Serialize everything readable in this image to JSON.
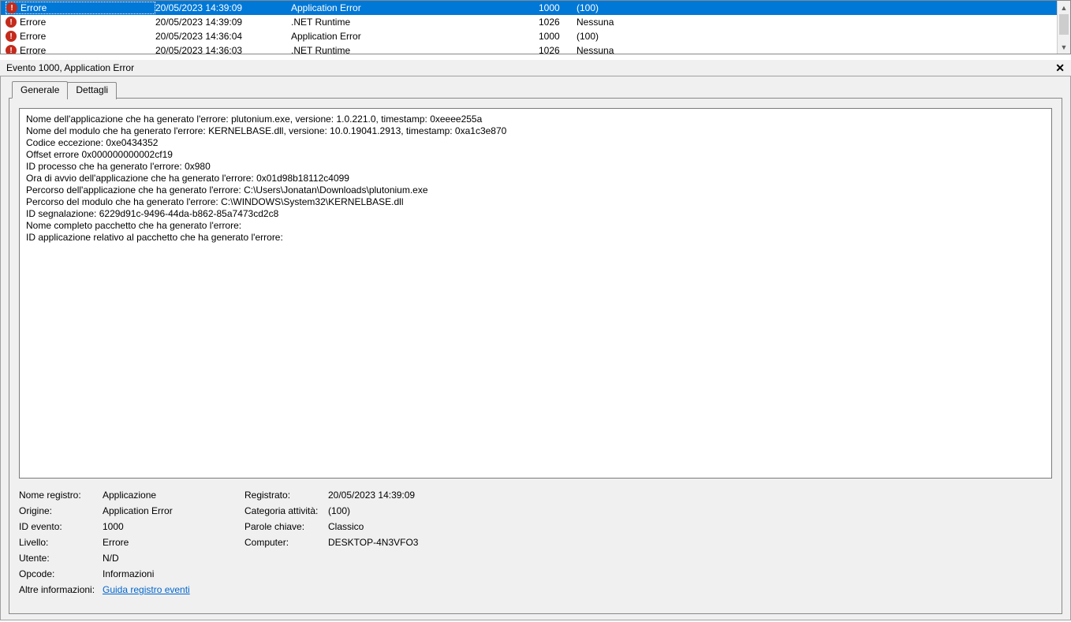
{
  "list": {
    "rows": [
      {
        "level": "Errore",
        "date": "20/05/2023 14:39:09",
        "source": "Application Error",
        "eventid": "1000",
        "category": "(100)",
        "selected": true
      },
      {
        "level": "Errore",
        "date": "20/05/2023 14:39:09",
        "source": ".NET Runtime",
        "eventid": "1026",
        "category": "Nessuna",
        "selected": false
      },
      {
        "level": "Errore",
        "date": "20/05/2023 14:36:04",
        "source": "Application Error",
        "eventid": "1000",
        "category": "(100)",
        "selected": false
      },
      {
        "level": "Errore",
        "date": "20/05/2023 14:36:03",
        "source": ".NET Runtime",
        "eventid": "1026",
        "category": "Nessuna",
        "selected": false
      }
    ]
  },
  "detail": {
    "header_title": "Evento 1000, Application Error",
    "tabs": {
      "general": "Generale",
      "details": "Dettagli"
    },
    "description": "Nome dell'applicazione che ha generato l'errore: plutonium.exe, versione: 1.0.221.0, timestamp: 0xeeee255a\nNome del modulo che ha generato l'errore: KERNELBASE.dll, versione: 10.0.19041.2913, timestamp: 0xa1c3e870\nCodice eccezione: 0xe0434352\nOffset errore 0x000000000002cf19\nID processo che ha generato l'errore: 0x980\nOra di avvio dell'applicazione che ha generato l'errore: 0x01d98b18112c4099\nPercorso dell'applicazione che ha generato l'errore: C:\\Users\\Jonatan\\Downloads\\plutonium.exe\nPercorso del modulo che ha generato l'errore: C:\\WINDOWS\\System32\\KERNELBASE.dll\nID segnalazione: 6229d91c-9496-44da-b862-85a7473cd2c8\nNome completo pacchetto che ha generato l'errore: \nID applicazione relativo al pacchetto che ha generato l'errore: ",
    "props": {
      "log_name_label": "Nome registro:",
      "log_name": "Applicazione",
      "source_label": "Origine:",
      "source": "Application Error",
      "eventid_label": "ID evento:",
      "eventid": "1000",
      "level_label": "Livello:",
      "level": "Errore",
      "user_label": "Utente:",
      "user": "N/D",
      "opcode_label": "Opcode:",
      "opcode": "Informazioni",
      "moreinfo_label": "Altre informazioni:",
      "moreinfo_link": "Guida registro eventi",
      "logged_label": "Registrato:",
      "logged": "20/05/2023 14:39:09",
      "taskcat_label": "Categoria attività:",
      "taskcat": "(100)",
      "keywords_label": "Parole chiave:",
      "keywords": "Classico",
      "computer_label": "Computer:",
      "computer": "DESKTOP-4N3VFO3"
    }
  }
}
